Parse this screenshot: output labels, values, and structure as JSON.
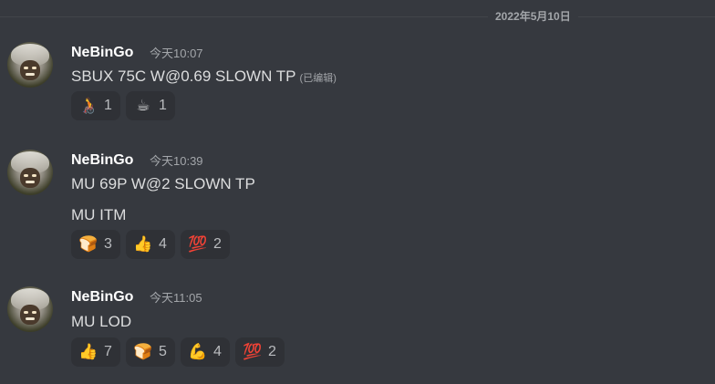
{
  "date_divider": "2022年5月10日",
  "messages": [
    {
      "username": "NeBinGo",
      "timestamp": "今天10:07",
      "lines": [
        "SBUX 75C W@0.69 SLOWN TP"
      ],
      "edited": "(已编辑)",
      "reactions": [
        {
          "emoji": "🧑‍🦽",
          "emoji_name": "person-in-wheelchair",
          "count": "1"
        },
        {
          "emoji": "☕",
          "emoji_name": "coffee",
          "count": "1"
        }
      ]
    },
    {
      "username": "NeBinGo",
      "timestamp": "今天10:39",
      "lines": [
        "MU 69P W@2 SLOWN TP",
        "MU ITM"
      ],
      "reactions": [
        {
          "emoji": "🍞",
          "emoji_name": "bread",
          "count": "3"
        },
        {
          "emoji": "👍",
          "emoji_name": "thumbs-up",
          "count": "4"
        },
        {
          "emoji": "💯",
          "emoji_name": "hundred-points",
          "count": "2"
        }
      ]
    },
    {
      "username": "NeBinGo",
      "timestamp": "今天11:05",
      "lines": [
        "MU LOD"
      ],
      "reactions": [
        {
          "emoji": "👍",
          "emoji_name": "thumbs-up",
          "count": "7"
        },
        {
          "emoji": "🍞",
          "emoji_name": "bread",
          "count": "5"
        },
        {
          "emoji": "💪",
          "emoji_name": "flexed-biceps",
          "count": "4"
        },
        {
          "emoji": "💯",
          "emoji_name": "hundred-points",
          "count": "2"
        }
      ]
    }
  ]
}
